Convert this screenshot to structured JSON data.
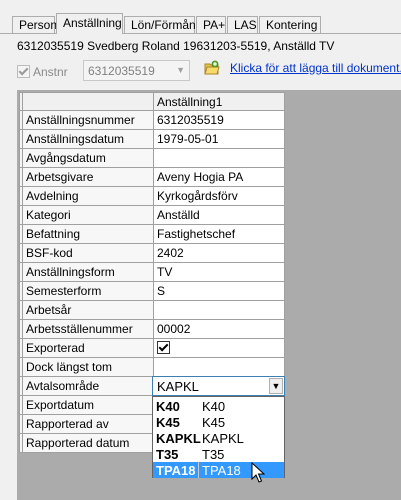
{
  "tabs": [
    {
      "label": "Person",
      "active": false
    },
    {
      "label": "Anställning",
      "active": true
    },
    {
      "label": "Lön/Förmån",
      "active": false
    },
    {
      "label": "PA+",
      "active": false
    },
    {
      "label": "LAS",
      "active": false
    },
    {
      "label": "Kontering",
      "active": false
    }
  ],
  "header": {
    "title": "6312035519 Svedberg Roland 19631203-5519, Anställd TV"
  },
  "anstnr": {
    "label": "Anstnr",
    "checked": true,
    "value": "6312035519"
  },
  "doc_link": {
    "text": "Klicka för att lägga till dokument...",
    "icon": "document-folder-icon"
  },
  "grid": {
    "column_header": "Anställning1",
    "rows": [
      {
        "label": "Anställningsnummer",
        "value": "6312035519"
      },
      {
        "label": "Anställningsdatum",
        "value": "1979-05-01"
      },
      {
        "label": "Avgångsdatum",
        "value": ""
      },
      {
        "label": "Arbetsgivare",
        "value": "Aveny Hogia PA"
      },
      {
        "label": "Avdelning",
        "value": "Kyrkogårdsförv"
      },
      {
        "label": "Kategori",
        "value": "Anställd"
      },
      {
        "label": "Befattning",
        "value": "Fastighetschef"
      },
      {
        "label": "BSF-kod",
        "value": "2402"
      },
      {
        "label": "Anställningsform",
        "value": "TV"
      },
      {
        "label": "Semesterform",
        "value": "S"
      },
      {
        "label": "Arbetsår",
        "value": ""
      },
      {
        "label": "Arbetsställenummer",
        "value": "00002"
      },
      {
        "label": "Exporterad",
        "value": ""
      },
      {
        "label": "Dock längst tom",
        "value": ""
      },
      {
        "label": "Avtalsområde",
        "value": ""
      },
      {
        "label": "Exportdatum",
        "value": ""
      },
      {
        "label": "Rapporterad av",
        "value": ""
      },
      {
        "label": "Rapporterad datum",
        "value": ""
      }
    ]
  },
  "avtalsomrade_combo": {
    "selected": "KAPKL",
    "options": [
      {
        "code": "K40",
        "name": "K40"
      },
      {
        "code": "K45",
        "name": "K45"
      },
      {
        "code": "KAPKL",
        "name": "KAPKL"
      },
      {
        "code": "T35",
        "name": "T35"
      },
      {
        "code": "TPA18",
        "name": "TPA18",
        "highlighted": true
      }
    ]
  },
  "colors": {
    "highlight": "#3399ff",
    "link": "#0033cc"
  }
}
